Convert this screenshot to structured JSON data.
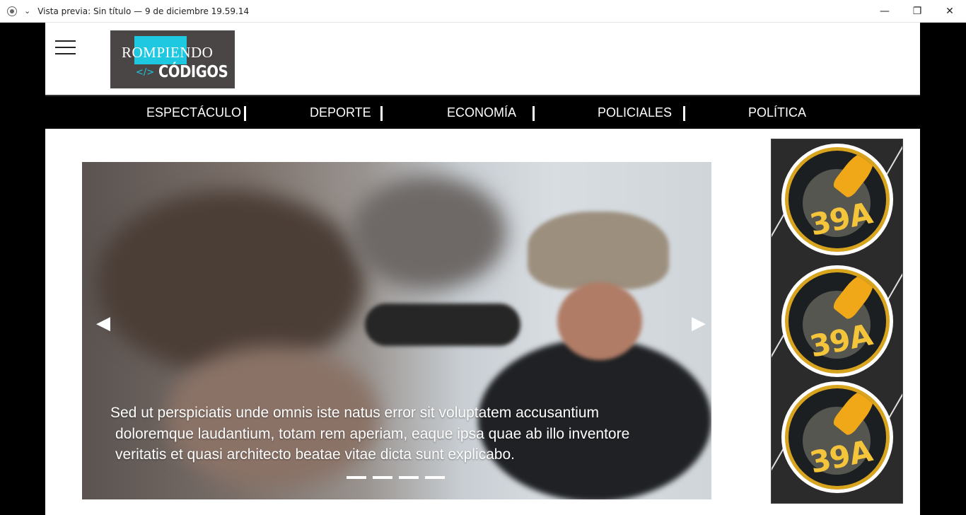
{
  "window": {
    "title": "Vista previa: Sin título — 9 de diciembre 19.59.14",
    "minimize": "—",
    "maximize": "❐",
    "close": "✕"
  },
  "logo": {
    "line1": "ROMPIENDO",
    "code_symbol": "</>",
    "line2": "CÓDIGOS"
  },
  "nav": {
    "items": [
      {
        "label": "ESPECTÁCULO"
      },
      {
        "label": "DEPORTE"
      },
      {
        "label": "ECONOMÍA"
      },
      {
        "label": "POLICIALES"
      },
      {
        "label": "POLÍTICA"
      }
    ]
  },
  "slider": {
    "caption_lines": [
      "Sed ut perspiciatis unde omnis iste natus error sit voluptatem accusantium",
      "doloremque laudantium, totam rem aperiam, eaque ipsa quae ab illo inventore",
      "veritatis et quasi architecto beatae vitae dicta sunt explicabo."
    ],
    "prev_icon": "◀",
    "next_icon": "▶",
    "indicator_count": 4
  },
  "ad": {
    "badge_text": "39A"
  }
}
